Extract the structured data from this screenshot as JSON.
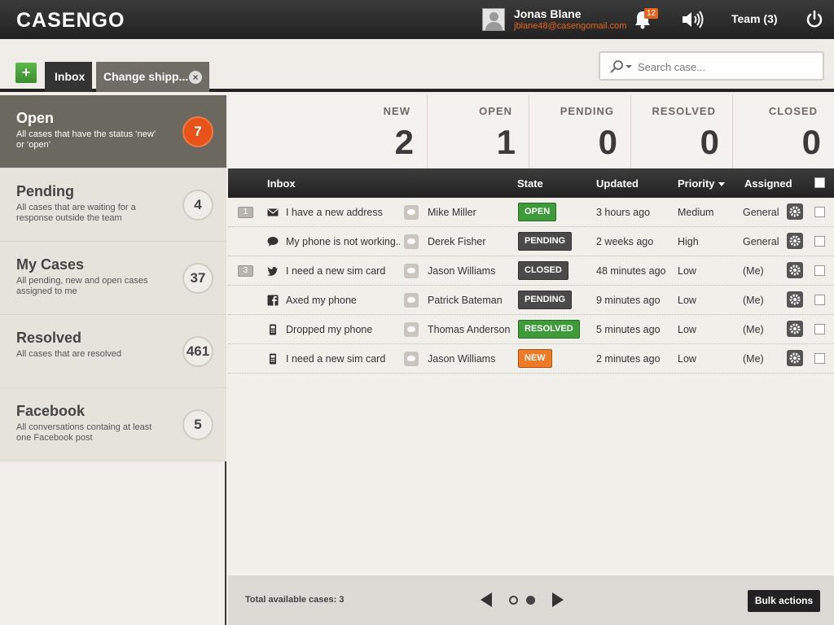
{
  "app": {
    "logo": "CASENGO",
    "user_name": "Jonas Blane",
    "user_email": "jblane48@casengomail.com",
    "notification_count": "12",
    "team_label": "Team (3)"
  },
  "tabs": {
    "add_label": "+",
    "inbox_label": "Inbox",
    "change_label": "Change shipp...",
    "close_symbol": "×"
  },
  "search": {
    "placeholder": "Search case..."
  },
  "sidebar": {
    "items": [
      {
        "title": "Open",
        "desc": "All cases that have the status ‘new’ or ‘open’",
        "count": "7"
      },
      {
        "title": "Pending",
        "desc": "All cases that are waiting for a response outside the team",
        "count": "4"
      },
      {
        "title": "My Cases",
        "desc": "All pending, new and open cases assigned to me",
        "count": "37"
      },
      {
        "title": "Resolved",
        "desc": "All cases that are resolved",
        "count": "461"
      },
      {
        "title": "Facebook",
        "desc": "All conversations containg at least one Facebook post",
        "count": "5"
      }
    ]
  },
  "stats": [
    {
      "label": "NEW",
      "value": "2"
    },
    {
      "label": "OPEN",
      "value": "1"
    },
    {
      "label": "PENDING",
      "value": "0"
    },
    {
      "label": "RESOLVED",
      "value": "0"
    },
    {
      "label": "CLOSED",
      "value": "0"
    }
  ],
  "table": {
    "headers": {
      "inbox": "Inbox",
      "state": "State",
      "updated": "Updated",
      "priority": "Priority",
      "assigned": "Assigned"
    },
    "rows": [
      {
        "num": "1",
        "channel": "email-icon",
        "subject": "I have a new address",
        "person": "Mike Miller",
        "state": "OPEN",
        "state_color": "#3f9a3a",
        "updated": "3 hours ago",
        "priority": "Medium",
        "assigned": "General"
      },
      {
        "num": "",
        "channel": "chat-icon",
        "subject": "My phone is not working...",
        "person": "Derek Fisher",
        "state": "PENDING",
        "state_color": "#4a4a4a",
        "updated": "2 weeks ago",
        "priority": "High",
        "assigned": "General"
      },
      {
        "num": "3",
        "channel": "twitter-icon",
        "subject": "I need a new sim card",
        "person": "Jason Williams",
        "state": "CLOSED",
        "state_color": "#4a4a4a",
        "updated": "48 minutes ago",
        "priority": "Low",
        "assigned": "(Me)"
      },
      {
        "num": "",
        "channel": "facebook-icon",
        "subject": "Axed my phone",
        "person": "Patrick Bateman",
        "state": "PENDING",
        "state_color": "#4a4a4a",
        "updated": "9 minutes ago",
        "priority": "Low",
        "assigned": "(Me)"
      },
      {
        "num": "",
        "channel": "phone-icon",
        "subject": "Dropped my phone",
        "person": "Thomas Anderson",
        "state": "RESOLVED",
        "state_color": "#3f9a3a",
        "updated": "5 minutes ago",
        "priority": "Low",
        "assigned": "(Me)"
      },
      {
        "num": "",
        "channel": "phone-icon",
        "subject": "I need a new sim card",
        "person": "Jason Williams",
        "state": "NEW",
        "state_color": "#ef7a24",
        "updated": "2 minutes ago",
        "priority": "Low",
        "assigned": "(Me)"
      }
    ]
  },
  "footer": {
    "total_label": "Total available cases: 3",
    "bulk_label": "Bulk actions"
  }
}
